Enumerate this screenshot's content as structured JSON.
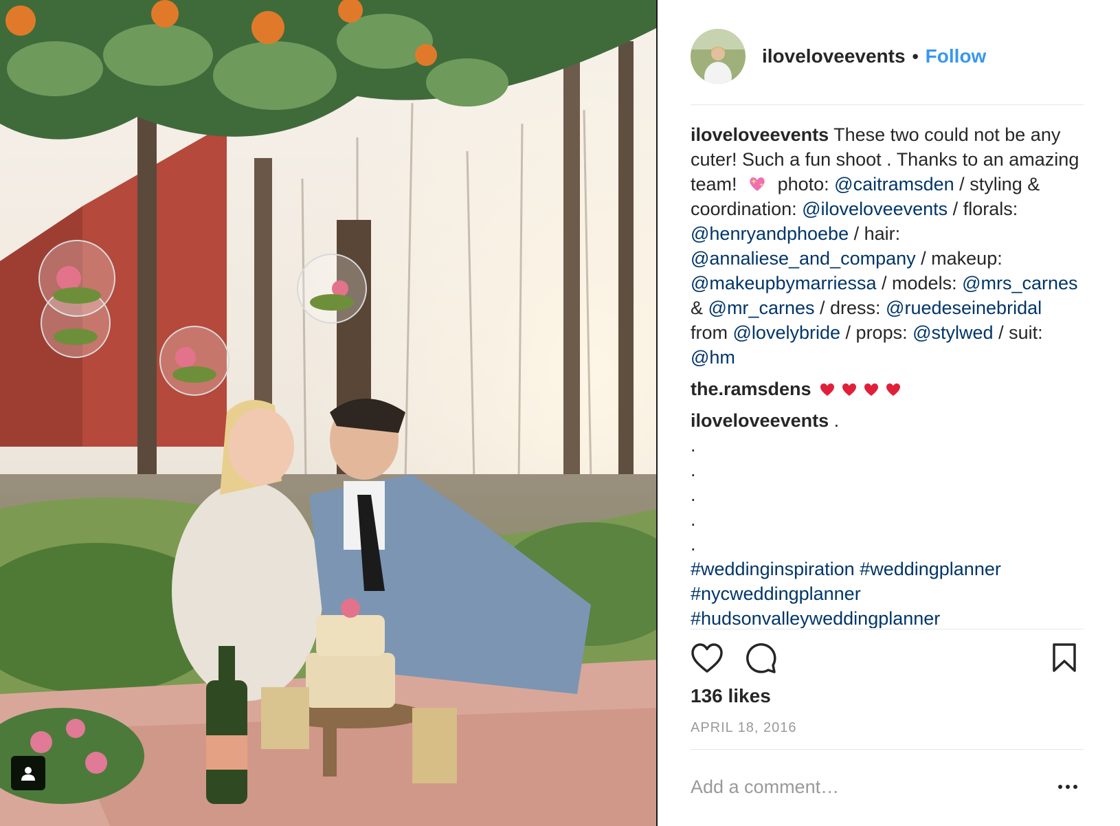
{
  "post": {
    "username": "iloveloveevents",
    "separator": "•",
    "follow_label": "Follow",
    "caption": {
      "username": "iloveloveevents",
      "text_1": "These two could not be any cuter! Such a fun shoot . Thanks to an amazing team!",
      "photo_label": "photo:",
      "photo_mention": "@caitramsden",
      "slash": "/",
      "styling_label": "styling & coordination:",
      "styling_mention": "@iloveloveevents",
      "florals_label": "florals:",
      "florals_mention": "@henryandphoebe",
      "hair_label": "/ hair:",
      "hair_mention": "@annaliese_and_company",
      "makeup_label": "/ makeup:",
      "makeup_mention": "@makeupbymarriessa",
      "models_label": "/ models:",
      "model_mention_1": "@mrs_carnes",
      "amp": "&",
      "model_mention_2": "@mr_carnes",
      "dress_label": "/ dress:",
      "dress_mention": "@ruedeseinebridal",
      "from_label": "from",
      "from_mention": "@lovelybride",
      "props_label": "props:",
      "props_mention": "@stylwed",
      "suit_label": "/ suit:",
      "suit_mention": "@hm"
    },
    "comments": [
      {
        "username": "the.ramsdens",
        "hearts": 4
      },
      {
        "username": "iloveloveevents",
        "text": ".",
        "dots": [
          ".",
          ".",
          ".",
          ".",
          "."
        ],
        "hashtags": [
          "#weddinginspiration",
          "#weddingplanner",
          "#nycweddingplanner",
          "#hudsonvalleyweddingplanner"
        ]
      }
    ],
    "likes": "136 likes",
    "date": "APRIL 18, 2016",
    "comment_placeholder": "Add a comment…"
  },
  "icons": {
    "like": "heart-outline-icon",
    "comment": "speech-bubble-icon",
    "save": "bookmark-icon",
    "more": "ellipsis-icon",
    "user_tag": "person-icon"
  },
  "colors": {
    "link": "#003569",
    "follow": "#3897f0",
    "meta": "#999999",
    "text": "#262626"
  }
}
